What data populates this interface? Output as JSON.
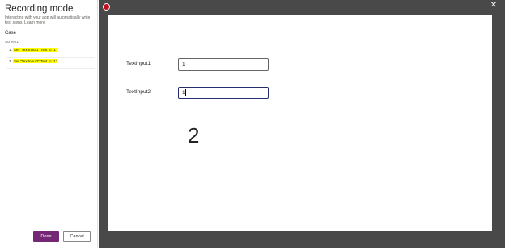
{
  "panel": {
    "title": "Recording mode",
    "description": "Interacting with your app will automatically write test steps. Learn more",
    "case_label": "Case",
    "screen_label": "Screen1",
    "steps": [
      {
        "number": "1.",
        "text": "Set \"TextInput1\".Text to \"1\""
      },
      {
        "number": "2.",
        "text": "Set \"TextInput2\".Text to \"1\""
      }
    ],
    "done_label": "Done",
    "cancel_label": "Cancel"
  },
  "stage": {
    "close_glyph": "✕"
  },
  "canvas": {
    "label1": "TextInput1",
    "input1_value": "1",
    "label2": "TextInput2",
    "input2_value": "1",
    "big_number": "2"
  },
  "colors": {
    "accent": "#742774",
    "record": "#c50f1f",
    "highlight": "#ffff00",
    "stage_bg": "#494949",
    "focus_border": "#242f6b"
  },
  "icons": {
    "record": "record-dot-icon",
    "close": "close-icon"
  }
}
